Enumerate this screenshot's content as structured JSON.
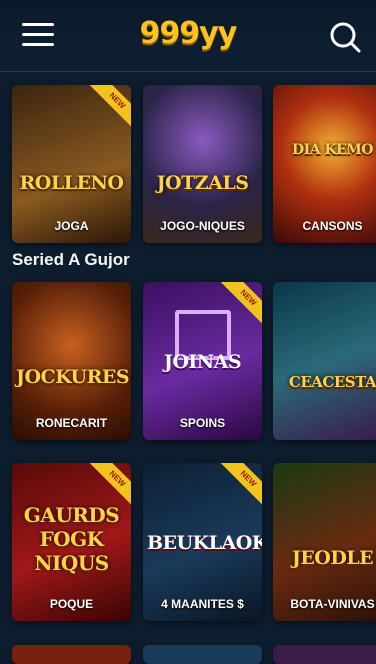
{
  "header": {
    "logo": "999yy"
  },
  "section": {
    "title": "Seried A Gujor"
  },
  "rows": [
    [
      {
        "title": "ROLLENO",
        "label": "JOGA",
        "ribbon": "NEW",
        "colors": [
          "#3a2410",
          "#8a5a20"
        ]
      },
      {
        "title": "JOTZALS",
        "label": "JOGO-NIQUES",
        "ribbon": "",
        "colors": [
          "#2a2448",
          "#5a4030"
        ]
      },
      {
        "title": "DIA KEMO",
        "label": "CANSONS",
        "ribbon": "",
        "colors": [
          "#5a1008",
          "#b03010"
        ]
      }
    ],
    [
      {
        "title": "JOCKURES",
        "label": "RONECARIT",
        "ribbon": "",
        "colors": [
          "#5a2008",
          "#a04a10"
        ]
      },
      {
        "title": "JOINAS",
        "label": "SPOINS",
        "ribbon": "NEW",
        "colors": [
          "#3a1060",
          "#6a2aa0"
        ]
      },
      {
        "title": "CEACESTA",
        "label": "",
        "ribbon": "",
        "colors": [
          "#0a3848",
          "#2a6a78"
        ]
      }
    ],
    [
      {
        "title": "GAURDS FOGK NIQUS",
        "label": "POQUE",
        "ribbon": "NEW",
        "colors": [
          "#5a0a0a",
          "#a01818"
        ]
      },
      {
        "title": "BEUKLAOK",
        "label": "4 MAANITES $",
        "ribbon": "NEW",
        "colors": [
          "#0c2034",
          "#1a3a5a"
        ]
      },
      {
        "title": "JEODLE",
        "label": "BOTA-VINIVAS",
        "ribbon": "",
        "colors": [
          "#1a3a14",
          "#6a2a10"
        ]
      }
    ]
  ]
}
